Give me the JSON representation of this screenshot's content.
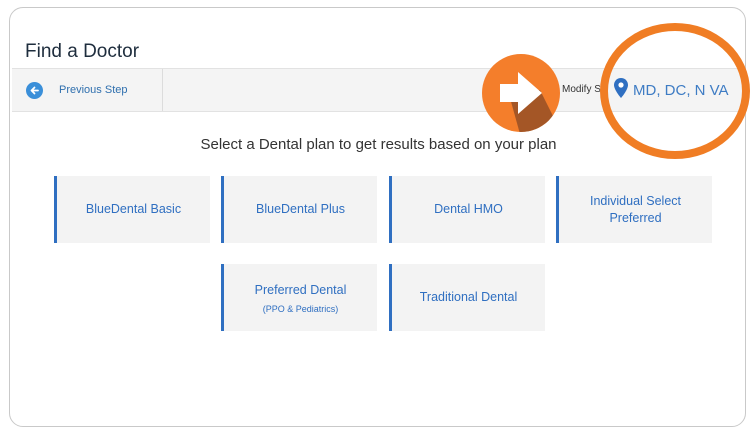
{
  "page": {
    "title": "Find a Doctor"
  },
  "stepbar": {
    "previous_label": "Previous Step",
    "modify_label": "Modify Se",
    "location": "MD, DC, N VA"
  },
  "subtitle": "Select a Dental plan to get results based on your plan",
  "plans": [
    {
      "name": "BlueDental Basic",
      "sub": ""
    },
    {
      "name": "BlueDental Plus",
      "sub": ""
    },
    {
      "name": "Dental HMO",
      "sub": ""
    },
    {
      "name": "Individual Select Preferred",
      "sub": ""
    },
    {
      "name": "Preferred Dental",
      "sub": "(PPO & Pediatrics)"
    },
    {
      "name": "Traditional Dental",
      "sub": ""
    }
  ],
  "colors": {
    "accent_blue": "#2f6fc1",
    "highlight_orange": "#f07d24",
    "play_orange": "#f47e2b"
  },
  "icons": {
    "previous": "arrow-left-circle-icon",
    "location": "map-pin-icon",
    "play": "play-icon"
  }
}
